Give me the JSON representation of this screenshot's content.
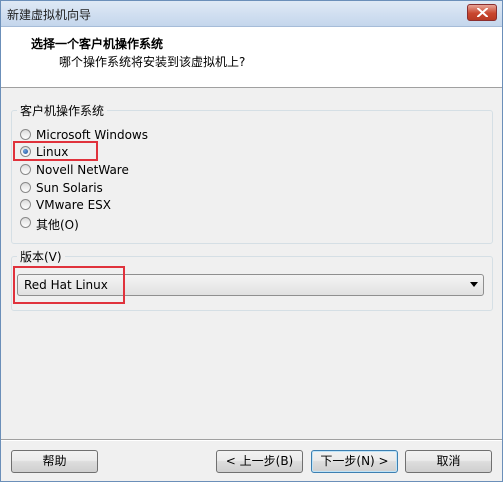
{
  "window": {
    "title": "新建虚拟机向导"
  },
  "header": {
    "title": "选择一个客户机操作系统",
    "subtitle": "哪个操作系统将安装到该虚拟机上?"
  },
  "os_group": {
    "label": "客户机操作系统",
    "options": [
      {
        "label": "Microsoft Windows",
        "selected": false
      },
      {
        "label": "Linux",
        "selected": true
      },
      {
        "label": "Novell NetWare",
        "selected": false
      },
      {
        "label": "Sun Solaris",
        "selected": false
      },
      {
        "label": "VMware ESX",
        "selected": false
      },
      {
        "label": "其他(O)",
        "selected": false
      }
    ]
  },
  "version_group": {
    "label": "版本(V)",
    "selected_value": "Red Hat Linux"
  },
  "buttons": {
    "help": "帮助",
    "back": "< 上一步(B)",
    "next": "下一步(N) >",
    "cancel": "取消"
  },
  "colors": {
    "highlight": "#e0323c",
    "title_bar": "#c4d6ec",
    "dialog_bg": "#f0f0f0"
  }
}
